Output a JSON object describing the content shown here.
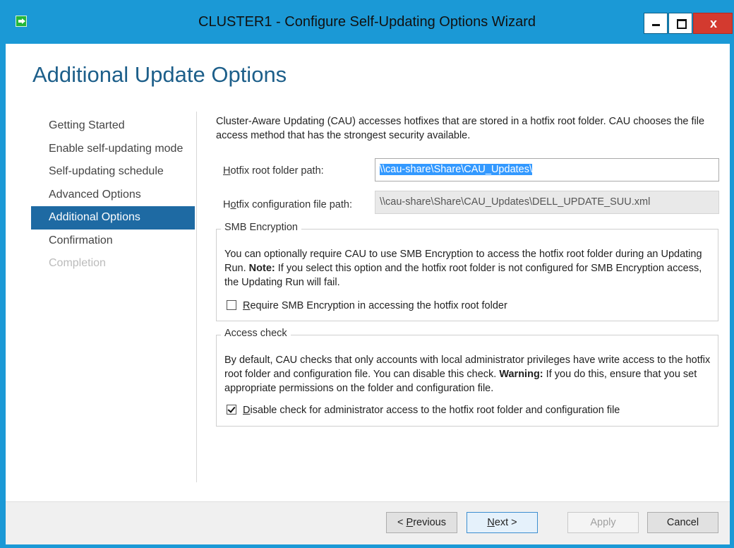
{
  "window": {
    "title": "CLUSTER1 - Configure Self-Updating Options Wizard",
    "controls": {
      "minimize": "",
      "maximize": "",
      "close": "x"
    }
  },
  "page": {
    "title": "Additional Update Options"
  },
  "nav": {
    "items": [
      {
        "label": "Getting Started",
        "state": "normal"
      },
      {
        "label": "Enable self-updating mode",
        "state": "normal"
      },
      {
        "label": "Self-updating schedule",
        "state": "normal"
      },
      {
        "label": "Advanced Options",
        "state": "normal"
      },
      {
        "label": "Additional Options",
        "state": "selected"
      },
      {
        "label": "Confirmation",
        "state": "normal"
      },
      {
        "label": "Completion",
        "state": "disabled"
      }
    ]
  },
  "content": {
    "intro": "Cluster-Aware Updating (CAU) accesses hotfixes that are stored in a hotfix root folder. CAU chooses the file access method that has the strongest security available.",
    "hotfix_root": {
      "label_access_key": "H",
      "label_rest": "otfix root folder path:",
      "value": "\\\\cau-share\\Share\\CAU_Updates\\"
    },
    "hotfix_config": {
      "label_pre": "H",
      "label_access_key": "o",
      "label_rest": "tfix configuration file path:",
      "value": "\\\\cau-share\\Share\\CAU_Updates\\DELL_UPDATE_SUU.xml"
    },
    "smb": {
      "legend": "SMB Encryption",
      "text_1": "You can optionally require CAU to use SMB Encryption to access the hotfix root folder during an Updating Run. ",
      "note_label": "Note:",
      "text_2": " If you select this option and the hotfix root folder is not configured for SMB Encryption access, the Updating Run will fail.",
      "checkbox_access_key": "R",
      "checkbox_rest": "equire SMB Encryption in accessing the hotfix root folder",
      "checked": false
    },
    "access": {
      "legend": "Access check",
      "text_1": "By default, CAU checks that only accounts with local administrator privileges have write access to the hotfix root folder and configuration file. You can disable this check. ",
      "warning_label": "Warning:",
      "text_2": " If you do this, ensure that you set appropriate permissions on the folder and configuration file.",
      "checkbox_access_key": "D",
      "checkbox_rest": "isable check for administrator access to the hotfix root folder and configuration file",
      "checked": true
    }
  },
  "footer": {
    "previous_pre": "< ",
    "previous_access_key": "P",
    "previous_rest": "revious",
    "next_access_key": "N",
    "next_rest": "ext >",
    "apply": "Apply",
    "cancel": "Cancel"
  }
}
